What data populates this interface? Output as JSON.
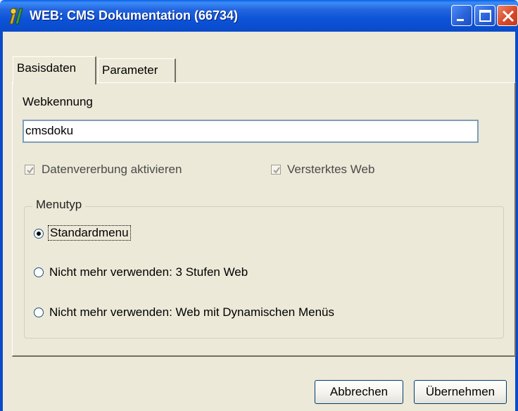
{
  "window": {
    "title": "WEB: CMS Dokumentation (66734)"
  },
  "tabs": [
    {
      "label": "Basisdaten",
      "active": true
    },
    {
      "label": "Parameter",
      "active": false
    }
  ],
  "form": {
    "webkennung_label": "Webkennung",
    "webkennung_value": "cmsdoku",
    "checkbox_datenvererbung": {
      "label": "Datenvererbung aktivieren",
      "checked": true
    },
    "checkbox_versteckt": {
      "label": "Versterktes Web",
      "checked": true
    },
    "menutyp": {
      "legend": "Menutyp",
      "options": [
        {
          "label": "Standardmenu",
          "selected": true
        },
        {
          "label": "Nicht mehr verwenden: 3 Stufen Web",
          "selected": false
        },
        {
          "label": "Nicht mehr verwenden: Web mit Dynamischen Menüs",
          "selected": false
        }
      ]
    }
  },
  "buttons": {
    "cancel": "Abbrechen",
    "apply": "Übernehmen"
  },
  "colors": {
    "titlebar": "#0a4bc9",
    "dialog_bg": "#ece9d8"
  }
}
